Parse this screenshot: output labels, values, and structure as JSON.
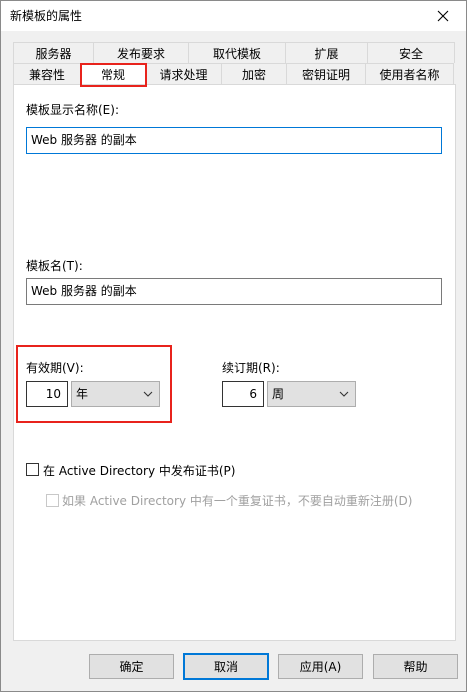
{
  "window": {
    "title": "新模板的属性",
    "close_icon": "close-icon"
  },
  "tabs": {
    "row1": [
      "服务器",
      "发布要求",
      "取代模板",
      "扩展",
      "安全"
    ],
    "row2": [
      "兼容性",
      "常规",
      "请求处理",
      "加密",
      "密钥证明",
      "使用者名称"
    ],
    "active": "常规"
  },
  "general": {
    "display_name_label": "模板显示名称(E):",
    "display_name_value": "Web 服务器 的副本",
    "template_name_label": "模板名(T):",
    "template_name_value": "Web 服务器 的副本",
    "validity_label": "有效期(V):",
    "validity_value": "10",
    "validity_unit": "年",
    "renewal_label": "续订期(R):",
    "renewal_value": "6",
    "renewal_unit": "周",
    "publish_ad_label": "在 Active Directory 中发布证书(P)",
    "publish_ad_checked": false,
    "no_reenroll_label": "如果 Active Directory 中有一个重复证书，不要自动重新注册(D)",
    "no_reenroll_checked": false
  },
  "buttons": {
    "ok": "确定",
    "cancel": "取消",
    "apply": "应用(A)",
    "help": "帮助"
  },
  "colors": {
    "highlight": "#e8231c",
    "focus": "#0078d7"
  }
}
